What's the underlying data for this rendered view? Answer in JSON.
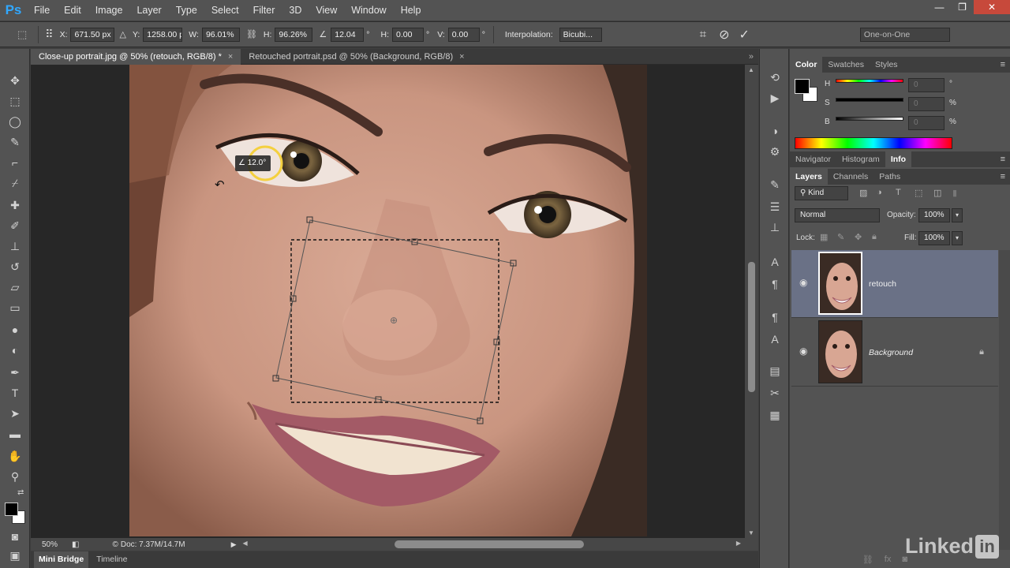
{
  "app": {
    "logo": "Ps",
    "menu": [
      "File",
      "Edit",
      "Image",
      "Layer",
      "Type",
      "Select",
      "Filter",
      "3D",
      "View",
      "Window",
      "Help"
    ],
    "window_controls": {
      "minimize": "—",
      "restore": "❐",
      "close": "✕"
    }
  },
  "options_bar": {
    "x_label": "X:",
    "x_value": "671.50 px",
    "y_label": "Y:",
    "y_value": "1258.00 p",
    "w_label": "W:",
    "w_value": "96.01%",
    "h_label": "H:",
    "h_value": "96.26%",
    "angle_value": "12.04",
    "angle_unit": "°",
    "hskew_label": "H:",
    "hskew_value": "0.00",
    "hskew_unit": "°",
    "vskew_label": "V:",
    "vskew_value": "0.00",
    "vskew_unit": "°",
    "interpolation_label": "Interpolation:",
    "interpolation_value": "Bicubi...",
    "workspace": "One-on-One"
  },
  "document_tabs": [
    {
      "label": "Close-up portrait.jpg @ 50% (retouch, RGB/8) *",
      "close": "×"
    },
    {
      "label": "Retouched portrait.psd @ 50% (Background, RGB/8)",
      "close": "×"
    }
  ],
  "canvas": {
    "rotation_readout": "12.0°"
  },
  "status": {
    "zoom": "50%",
    "doc_info": "Doc: 7.37M/14.7M"
  },
  "bottom_tabs": [
    "Mini Bridge",
    "Timeline"
  ],
  "panels": {
    "color_tabs": [
      "Color",
      "Swatches",
      "Styles"
    ],
    "hsb": {
      "h_label": "H",
      "h_value": "0",
      "h_unit": "°",
      "s_label": "S",
      "s_value": "0",
      "s_unit": "%",
      "b_label": "B",
      "b_value": "0",
      "b_unit": "%"
    },
    "nav_tabs": [
      "Navigator",
      "Histogram",
      "Info"
    ],
    "layer_tabs": [
      "Layers",
      "Channels",
      "Paths"
    ],
    "kind_filter": "Kind",
    "blend_mode": "Normal",
    "opacity_label": "Opacity:",
    "opacity_value": "100%",
    "lock_label": "Lock:",
    "fill_label": "Fill:",
    "fill_value": "100%",
    "layers": [
      {
        "name": "retouch",
        "selected": true
      },
      {
        "name": "Background",
        "selected": false
      }
    ]
  },
  "watermark": {
    "text": "Linked",
    "badge": "in"
  },
  "colors": {
    "accent": "#31a8ff",
    "selected_layer": "#6a7186",
    "close_button": "#c7493b",
    "rotate_handle": "#f4d03f"
  }
}
